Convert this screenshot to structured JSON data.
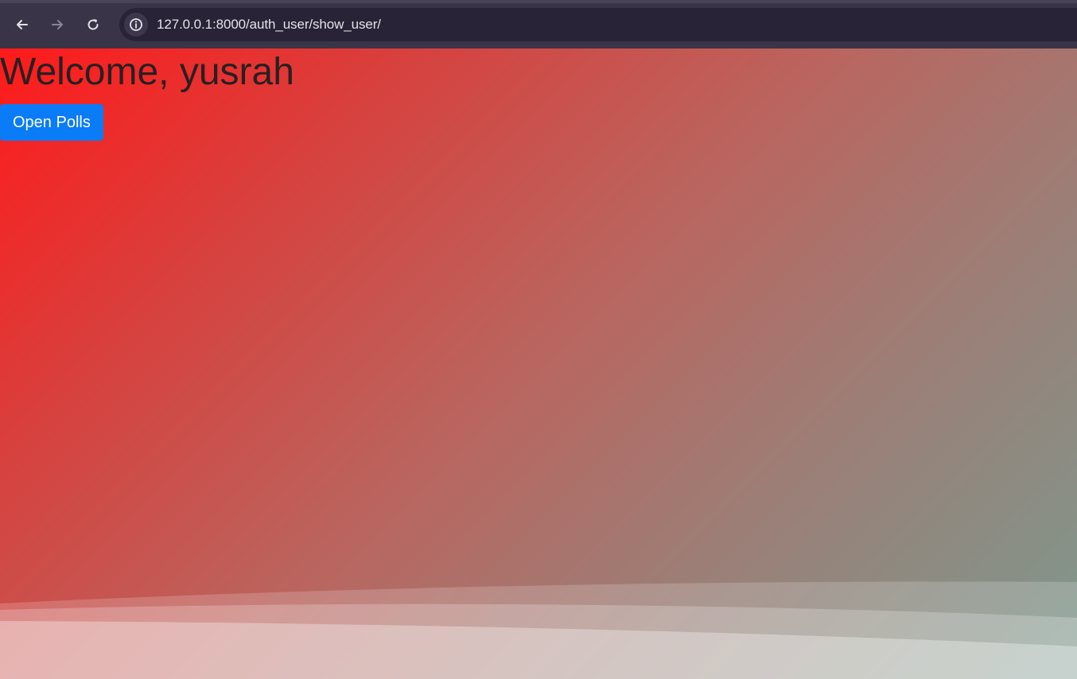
{
  "browser": {
    "url": "127.0.0.1:8000/auth_user/show_user/"
  },
  "page": {
    "heading": "Welcome, yusrah",
    "open_polls_label": "Open Polls"
  },
  "colors": {
    "browser_toolbar": "#3a3449",
    "address_bar": "#282336",
    "heading_text": "#2a1f22",
    "button_primary": "#0a7cf7",
    "gradient_start": "#ff1a1a",
    "gradient_end": "#7e998e"
  },
  "icons": {
    "back": "arrow-left-icon",
    "forward": "arrow-right-icon",
    "reload": "reload-icon",
    "site_info": "info-icon"
  }
}
